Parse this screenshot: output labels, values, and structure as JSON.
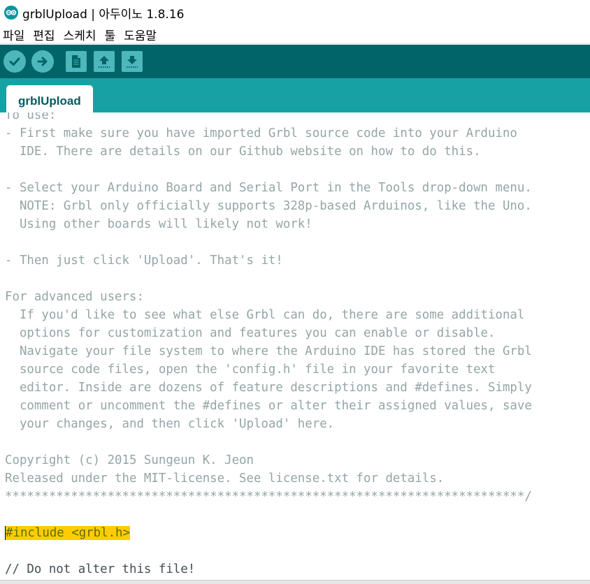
{
  "window": {
    "title": "grblUpload | 아두이노 1.8.16"
  },
  "menu": {
    "items": [
      "파일",
      "편집",
      "스케치",
      "툴",
      "도움말"
    ]
  },
  "toolbar": {
    "buttons": [
      {
        "name": "verify",
        "icon": "check-icon"
      },
      {
        "name": "upload",
        "icon": "arrow-right-icon"
      },
      {
        "name": "new",
        "icon": "new-file-icon"
      },
      {
        "name": "open",
        "icon": "open-up-arrow-icon"
      },
      {
        "name": "save",
        "icon": "save-down-arrow-icon"
      }
    ]
  },
  "tabs": [
    {
      "label": "grblUpload",
      "active": true
    }
  ],
  "editor": {
    "lines": [
      {
        "text": "To use:",
        "style": "comment"
      },
      {
        "text": "- First make sure you have imported Grbl source code into your Arduino",
        "style": "comment"
      },
      {
        "text": "  IDE. There are details on our Github website on how to do this.",
        "style": "comment"
      },
      {
        "text": "",
        "style": "comment"
      },
      {
        "text": "- Select your Arduino Board and Serial Port in the Tools drop-down menu.",
        "style": "comment"
      },
      {
        "text": "  NOTE: Grbl only officially supports 328p-based Arduinos, like the Uno.",
        "style": "comment"
      },
      {
        "text": "  Using other boards will likely not work!",
        "style": "comment"
      },
      {
        "text": "",
        "style": "comment"
      },
      {
        "text": "- Then just click 'Upload'. That's it!",
        "style": "comment"
      },
      {
        "text": "",
        "style": "comment"
      },
      {
        "text": "For advanced users:",
        "style": "comment"
      },
      {
        "text": "  If you'd like to see what else Grbl can do, there are some additional",
        "style": "comment"
      },
      {
        "text": "  options for customization and features you can enable or disable.",
        "style": "comment"
      },
      {
        "text": "  Navigate your file system to where the Arduino IDE has stored the Grbl",
        "style": "comment"
      },
      {
        "text": "  source code files, open the 'config.h' file in your favorite text",
        "style": "comment"
      },
      {
        "text": "  editor. Inside are dozens of feature descriptions and #defines. Simply",
        "style": "comment"
      },
      {
        "text": "  comment or uncomment the #defines or alter their assigned values, save",
        "style": "comment"
      },
      {
        "text": "  your changes, and then click 'Upload' here.",
        "style": "comment"
      },
      {
        "text": "",
        "style": "comment"
      },
      {
        "text": "Copyright (c) 2015 Sungeun K. Jeon",
        "style": "comment"
      },
      {
        "text": "Released under the MIT-license. See license.txt for details.",
        "style": "comment"
      },
      {
        "text": "***********************************************************************/",
        "style": "comment"
      },
      {
        "text": "",
        "style": "normal"
      },
      {
        "text": "#include <grbl.h>",
        "style": "include"
      },
      {
        "text": "",
        "style": "normal"
      },
      {
        "text": "// Do not alter this file!",
        "style": "normal"
      }
    ]
  },
  "colors": {
    "toolbar_bg": "#006468",
    "tabstrip_bg": "#17a1a5",
    "button_bg": "#4db7bb",
    "comment_text": "#95a5a6",
    "include_highlight": "#ffcc00"
  }
}
